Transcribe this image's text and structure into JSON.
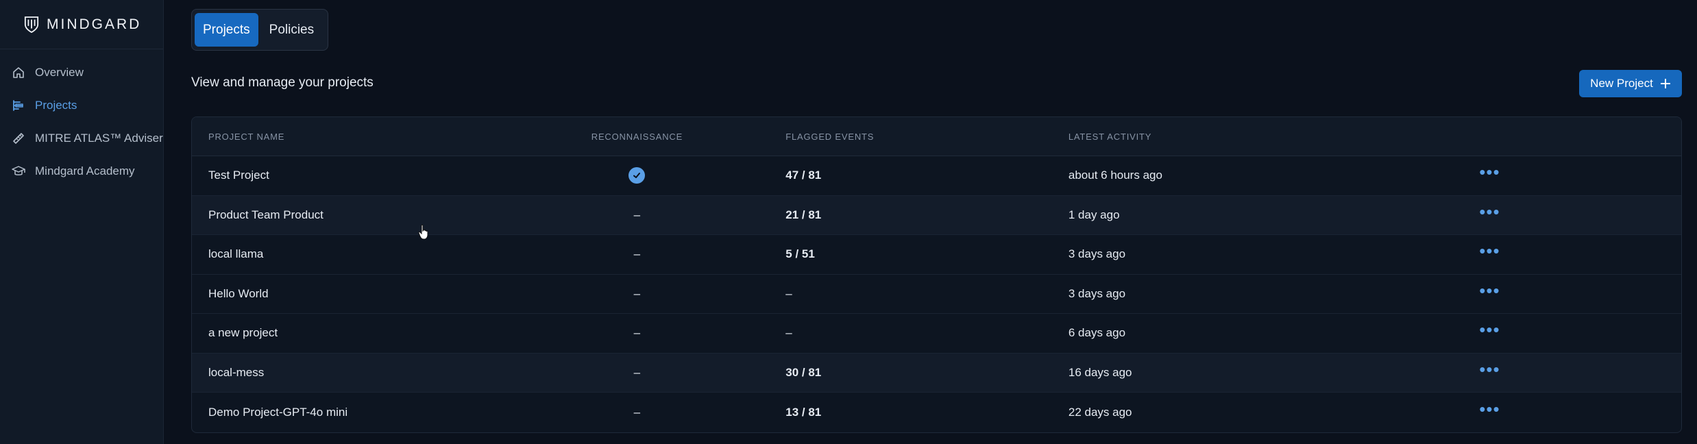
{
  "brand": {
    "name": "MINDGARD",
    "icon": "shield-logo-icon"
  },
  "sidebar": {
    "items": [
      {
        "label": "Overview",
        "icon": "home-icon",
        "active": false
      },
      {
        "label": "Projects",
        "icon": "projects-icon",
        "active": true
      },
      {
        "label": "MITRE ATLAS™ Adviser",
        "icon": "ruler-icon",
        "active": false
      },
      {
        "label": "Mindgard Academy",
        "icon": "graduation-cap-icon",
        "active": false
      }
    ]
  },
  "tabs": [
    {
      "label": "Projects",
      "active": true
    },
    {
      "label": "Policies",
      "active": false
    }
  ],
  "page": {
    "subtitle": "View and manage your projects",
    "new_button": "New Project"
  },
  "table": {
    "headers": [
      "PROJECT NAME",
      "RECONNAISSANCE",
      "FLAGGED EVENTS",
      "LATEST ACTIVITY"
    ],
    "rows": [
      {
        "name": "Test Project",
        "recon": "check",
        "flagged": "47 / 81",
        "activity": "about 6 hours ago"
      },
      {
        "name": "Product Team Product",
        "recon": "–",
        "flagged": "21 / 81",
        "activity": "1 day ago"
      },
      {
        "name": "local llama",
        "recon": "–",
        "flagged": "5 / 51",
        "activity": "3 days ago"
      },
      {
        "name": "Hello World",
        "recon": "–",
        "flagged": "–",
        "activity": "3 days ago"
      },
      {
        "name": "a new project",
        "recon": "–",
        "flagged": "–",
        "activity": "6 days ago"
      },
      {
        "name": "local-mess",
        "recon": "–",
        "flagged": "30 / 81",
        "activity": "16 days ago"
      },
      {
        "name": "Demo Project-GPT-4o mini",
        "recon": "–",
        "flagged": "13 / 81",
        "activity": "22 days ago"
      }
    ],
    "actions_label": "•••"
  },
  "colors": {
    "accent": "#1769c0",
    "link": "#5a9fe6",
    "background": "#0b111c",
    "sidebar": "#111a27"
  }
}
